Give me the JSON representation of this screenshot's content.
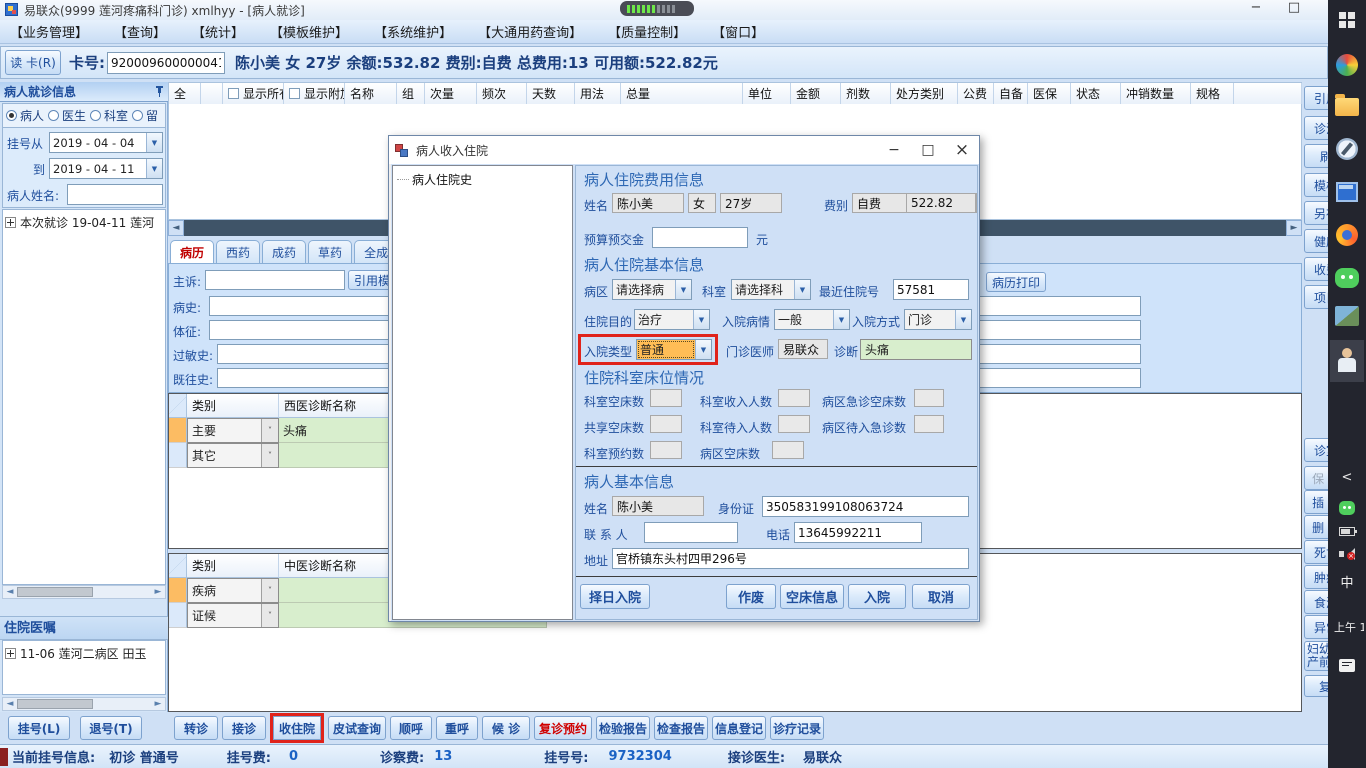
{
  "titlebar": {
    "title": "易联众(9999 莲河疼痛科门诊) xmlhyy - [病人就诊]",
    "minimize": "−",
    "restore": "□"
  },
  "menu": {
    "items": [
      "【业务管理】",
      "【查询】",
      "【统计】",
      "【模板维护】",
      "【系统维护】",
      "【大通用药查询】",
      "【质量控制】",
      "【窗口】"
    ]
  },
  "patient_bar": {
    "read_card": "读 卡(R)",
    "card_label": "卡号:",
    "card_no": "920009600000041",
    "summary": "陈小美 女 27岁 余额:532.82 费别:自费 总费用:13 可用额:522.82元"
  },
  "sidebar": {
    "title": "病人就诊信息",
    "radios": [
      "病人",
      "医生",
      "科室",
      "留"
    ],
    "date_from_label": "挂号从",
    "date_from": "2019 - 04 - 04",
    "date_to_label": "到",
    "date_to": "2019 - 04 - 11",
    "name_label": "病人姓名:",
    "tree_item": "本次就诊 19-04-11 莲河",
    "orders_title": "住院医嘱",
    "orders_item": "11-06 莲河二病区 田玉",
    "register_btn": "挂号(L)",
    "refund_btn": "退号(T)"
  },
  "grid": {
    "col_all": "全",
    "show_all": "显示所有",
    "show_extra": "显示附加",
    "columns": [
      "名称",
      "组",
      "次量",
      "频次",
      "天数",
      "用法",
      "总量",
      "单位",
      "金额",
      "剂数",
      "处方类别",
      "公费",
      "自备",
      "医保",
      "状态",
      "冲销数量",
      "规格"
    ]
  },
  "tabs": {
    "items": [
      "病历",
      "西药",
      "成药",
      "草药",
      "全成分"
    ]
  },
  "emr": {
    "fields": [
      "主诉:",
      "病史:",
      "体征:",
      "过敏史:",
      "既往史:"
    ],
    "quote_btn": "引用模板",
    "print_btn": "病历打印"
  },
  "west_diag": {
    "h_type": "类别",
    "h_name": "西医诊断名称",
    "rows": [
      {
        "type": "主要",
        "name": "头痛"
      },
      {
        "type": "其它",
        "name": ""
      }
    ]
  },
  "cn_diag": {
    "h_type": "类别",
    "h_name": "中医诊断名称",
    "rows": [
      {
        "type": "疾病",
        "name": ""
      },
      {
        "type": "证候",
        "name": ""
      }
    ]
  },
  "footer": {
    "buttons": [
      "转诊",
      "接诊",
      "收住院",
      "皮试查询",
      "顺呼",
      "重呼",
      "候 诊",
      "复诊预约",
      "检验报告",
      "检查报告",
      "信息登记",
      "诊疗记录"
    ]
  },
  "status": {
    "left_label": "当前挂号信息:",
    "left_value": "初诊 普通号",
    "reg_fee_label": "挂号费:",
    "reg_fee": "0",
    "exam_fee_label": "诊察费:",
    "exam_fee": "13",
    "reg_no_label": "挂号号:",
    "reg_no": "9732304",
    "doctor_label": "接诊医生:",
    "doctor": "易联众"
  },
  "right_strip": {
    "items": [
      "引用",
      "诊治",
      "刷",
      "模板",
      "另存",
      "健康",
      "收费",
      "项目",
      "诊室",
      "保 存",
      "插 入",
      "删 除",
      "死亡",
      "肿瘤",
      "食源",
      "异常",
      "妇幼产前",
      "复"
    ]
  },
  "dialog": {
    "title": "病人收入住院",
    "minimize": "−",
    "maximize": "□",
    "close": "×",
    "tree_item": "病人住院史",
    "sec_fee": "病人住院费用信息",
    "name_label": "姓名",
    "name": "陈小美",
    "gender": "女",
    "age": "27岁",
    "fee_type_label": "费别",
    "fee_type": "自费",
    "balance_label": "余额",
    "balance": "522.82",
    "prepay_label": "预算预交金",
    "yuan": "元",
    "sec_basic": "病人住院基本信息",
    "ward_label": "病区",
    "ward": "请选择病",
    "dept_label": "科室",
    "dept": "请选择科",
    "recent_no_label": "最近住院号",
    "recent_no": "57581",
    "purpose_label": "住院目的",
    "purpose": "治疗",
    "condition_label": "入院病情",
    "condition": "一般",
    "admit_way_label": "入院方式",
    "admit_way": "门诊",
    "admit_type_label": "入院类型",
    "admit_type": "普通",
    "opd_doctor_label": "门诊医师",
    "opd_doctor": "易联众",
    "diagnosis_label": "诊断",
    "diagnosis": "头痛",
    "sec_beds": "住院科室床位情况",
    "beds": [
      {
        "label": "科室空床数"
      },
      {
        "label": "科室收入人数"
      },
      {
        "label": "病区急诊空床数"
      },
      {
        "label": "共享空床数"
      },
      {
        "label": "科室待入人数"
      },
      {
        "label": "病区待入急诊数"
      },
      {
        "label": "科室预约数"
      },
      {
        "label": "病区空床数"
      }
    ],
    "sec_patient": "病人基本信息",
    "p_name_label": "姓名",
    "p_name": "陈小美",
    "id_label": "身份证",
    "id_no": "350583199108063724",
    "contact_label": "联 系 人",
    "phone_label": "电话",
    "phone": "13645992211",
    "addr_label": "地址",
    "addr": "官桥镇东头村四甲296号",
    "buttons": [
      "择日入院",
      "作废",
      "空床信息",
      "入院",
      "取消"
    ]
  },
  "taskbar": {
    "ime": "中",
    "time": "上午 1",
    "tray_chevron": "<"
  },
  "colors": {
    "highlight_red": "#e0231b",
    "selection_orange": "#ffbd56",
    "diagnosis_green": "#d8eecd",
    "accent_navy": "#1f4e9c",
    "taskbar_bg": "#23252e"
  }
}
